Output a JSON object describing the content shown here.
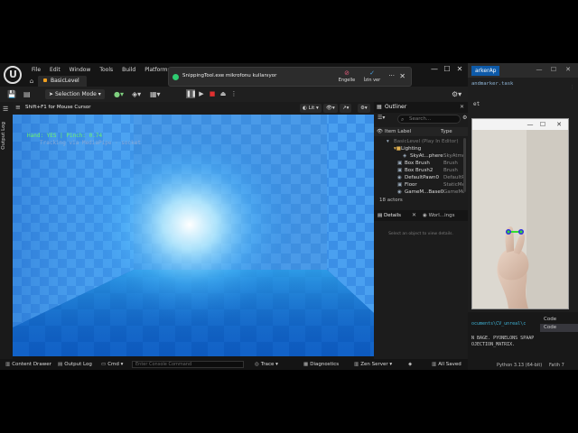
{
  "vscode": {
    "tab_label": "arkerAp",
    "file_label": "andmarker.task",
    "code_fragment": "et",
    "terminal_lines": [
      "ocuments\\CV_unreal\\c",
      "N BAGE. PYONELONS SPAAP",
      "OJECTION_MATRIX."
    ],
    "code_items": [
      "Code",
      "Code"
    ],
    "status_text": "Python 3.13 (64-bit)",
    "status_right": "Fatih 7"
  },
  "camera": {
    "min_label": "—",
    "max_label": "☐",
    "close_label": "✕"
  },
  "ue": {
    "menu": [
      "File",
      "Edit",
      "Window",
      "Tools",
      "Build",
      "Platforms",
      "S"
    ],
    "level_tab": "BasicLevel",
    "home_icon": "⌂",
    "snipping": {
      "message": "SnippingTool.exe mikrofonu kullanıyor",
      "actions": [
        {
          "label": "Engelle",
          "glyph": "⊘",
          "color": "#e05a7a"
        },
        {
          "label": "İzin ver",
          "glyph": "✓",
          "color": "#4aa0e0"
        }
      ],
      "more": "···",
      "close": "✕"
    },
    "win_min": "—",
    "win_max": "☐",
    "win_close": "✕",
    "toolbar": {
      "selection_mode": "Selection Mode"
    },
    "left_strip_label": "Output Log",
    "viewport": {
      "hint": "Shift+F1 for Mouse Cursor",
      "lit_label": "Lit",
      "overlay_line1": "Hand: YES | Pinch: 0.74",
      "overlay_line2": "Tracking via MediaPipe  ·  socket"
    },
    "outliner": {
      "title": "Outliner",
      "search_placeholder": "Search...",
      "col_label": "Item Label",
      "col_type": "Type",
      "rows": [
        {
          "label": "BasicLevel (Play In Editor)",
          "type": "",
          "indent": 22,
          "kind": "level",
          "icon": "▾"
        },
        {
          "label": "Lighting",
          "type": "",
          "indent": 30,
          "kind": "folder",
          "icon": "▾■"
        },
        {
          "label": "SkyAt...phere",
          "type": "SkyAtmo",
          "indent": 40,
          "kind": "item",
          "icon": "◈"
        },
        {
          "label": "Box Brush",
          "type": "Brush",
          "indent": 34,
          "kind": "item",
          "icon": "▣"
        },
        {
          "label": "Box Brush2",
          "type": "Brush",
          "indent": 34,
          "kind": "item",
          "icon": "▣"
        },
        {
          "label": "DefaultPawn0",
          "type": "DefaultP",
          "indent": 34,
          "kind": "item",
          "icon": "◉"
        },
        {
          "label": "Floor",
          "type": "StaticMe",
          "indent": 34,
          "kind": "item",
          "icon": "▣"
        },
        {
          "label": "GameM...Base0",
          "type": "GameMo",
          "indent": 34,
          "kind": "item",
          "icon": "◉"
        }
      ],
      "count": "18 actors"
    },
    "details": {
      "tab1": "Details",
      "tab2": "Worl...ings",
      "empty_text": "Select an object to view details."
    },
    "bottom": {
      "content_drawer": "Content Drawer",
      "output_log": "Output Log",
      "cmd": "Cmd",
      "console_placeholder": "Enter Console Command",
      "trace": "Trace",
      "diagnostics": "Diagnostics",
      "zen": "Zen Server",
      "all_saved": "All Saved"
    }
  }
}
